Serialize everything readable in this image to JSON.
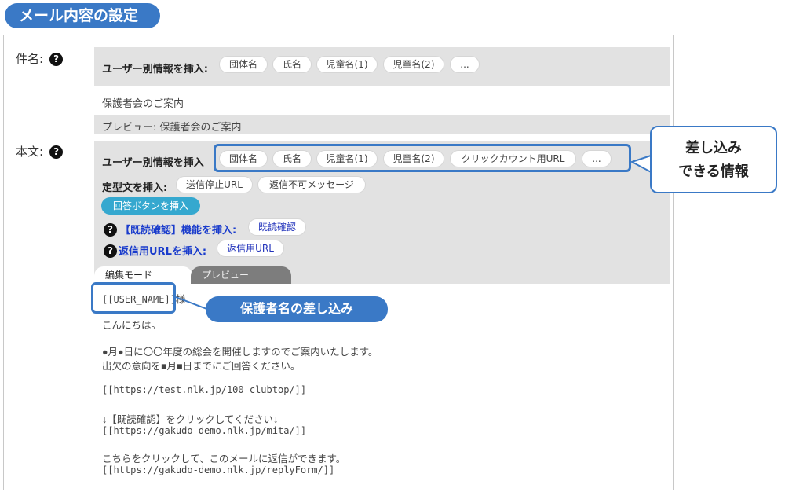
{
  "section_title": "メール内容の設定",
  "subject": {
    "label": "件名:",
    "insert_label": "ユーザー別情報を挿入:",
    "insert_tags": [
      "団体名",
      "氏名",
      "児童名(1)",
      "児童名(2)",
      "..."
    ],
    "value": "保護者会のご案内",
    "preview": "プレビュー: 保護者会のご案内"
  },
  "body": {
    "label": "本文:",
    "insert_label": "ユーザー別情報を挿入",
    "insert_tags": [
      "団体名",
      "氏名",
      "児童名(1)",
      "児童名(2)",
      "クリックカウント用URL",
      "..."
    ],
    "template_label": "定型文を挿入:",
    "template_tags": [
      "送信停止URL",
      "返信不可メッセージ"
    ],
    "answer_button": "回答ボタンを挿入",
    "read_confirm_label": "【既読確認】機能を挿入:",
    "read_confirm_tag": "既読確認",
    "reply_url_label": "返信用URLを挿入:",
    "reply_url_tag": "返信用URL",
    "tabs": [
      "編集モード",
      "プレビュー"
    ],
    "lines": {
      "user_name": "[[USER_NAME]]",
      "honorific": "様",
      "greeting": "こんにちは。",
      "p1a": "●月●日に〇〇年度の総会を開催しますのでご案内いたします。",
      "p1b": "出欠の意向を■月■日までにご回答ください。",
      "url1": "[[https://test.nlk.jp/100_clubtop/]]",
      "p2": "↓【既読確認】をクリックしてください↓",
      "url2": "[[https://gakudo-demo.nlk.jp/mita/]]",
      "p3": "こちらをクリックして、このメールに返信ができます。",
      "url3": "[[https://gakudo-demo.nlk.jp/replyForm/]]"
    }
  },
  "help_icon": "?",
  "callouts": {
    "insertable_line1": "差し込み",
    "insertable_line2": "できる情報",
    "guardian_name": "保護者名の差し込み"
  },
  "colors": {
    "accent": "#3a79c6",
    "answer_button": "#35a8cf",
    "gray_panel": "#e2e2e2"
  }
}
